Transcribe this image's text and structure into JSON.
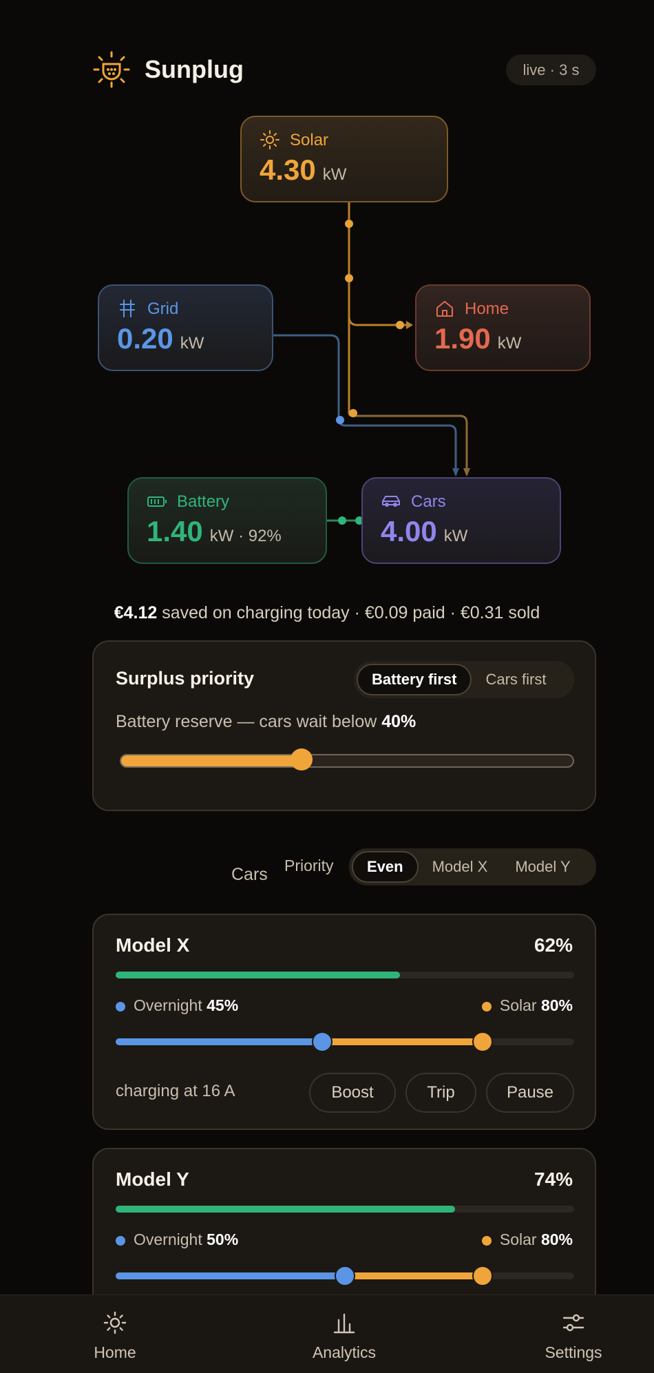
{
  "header": {
    "title": "Sunplug",
    "live": "live · 3 s"
  },
  "flow": {
    "solar": {
      "label": "Solar",
      "value": "4.30",
      "unit": "kW"
    },
    "grid": {
      "label": "Grid",
      "value": "0.20",
      "unit": "kW"
    },
    "home": {
      "label": "Home",
      "value": "1.90",
      "unit": "kW"
    },
    "battery": {
      "label": "Battery",
      "value": "1.40",
      "unit": "kW · 92%"
    },
    "cars": {
      "label": "Cars",
      "value": "4.00",
      "unit": "kW"
    }
  },
  "summary": {
    "saved": "€4.12",
    "rest": "saved on charging today · €0.09 paid · €0.31 sold"
  },
  "surplus": {
    "title": "Surplus priority",
    "options": [
      "Battery first",
      "Cars first"
    ],
    "selected": "Battery first",
    "reserve_text": "Battery reserve — cars wait below",
    "reserve_value": "40%",
    "reserve_level": 0.4
  },
  "cars": {
    "label": "Cars",
    "priority_label": "Priority",
    "options": [
      "Even",
      "Model X",
      "Model Y"
    ],
    "selected": "Even",
    "list": [
      {
        "name": "Model X",
        "pct": "62%",
        "charge_level": 0.62,
        "overnight_label": "Overnight",
        "overnight": "45%",
        "overnight_level": 0.45,
        "solar_label": "Solar",
        "solar": "80%",
        "solar_level": 0.8,
        "status": "charging at 16 A",
        "buttons": [
          "Boost",
          "Trip",
          "Pause"
        ]
      },
      {
        "name": "Model Y",
        "pct": "74%",
        "charge_level": 0.74,
        "overnight_label": "Overnight",
        "overnight": "50%",
        "overnight_level": 0.5,
        "solar_label": "Solar",
        "solar": "80%",
        "solar_level": 0.8
      }
    ]
  },
  "nav": {
    "home": "Home",
    "analytics": "Analytics",
    "settings": "Settings"
  },
  "colors": {
    "solar": "#f0a53a",
    "grid": "#5b96e6",
    "home": "#e3694f",
    "battery": "#2fb57a",
    "cars": "#8f86ec"
  }
}
